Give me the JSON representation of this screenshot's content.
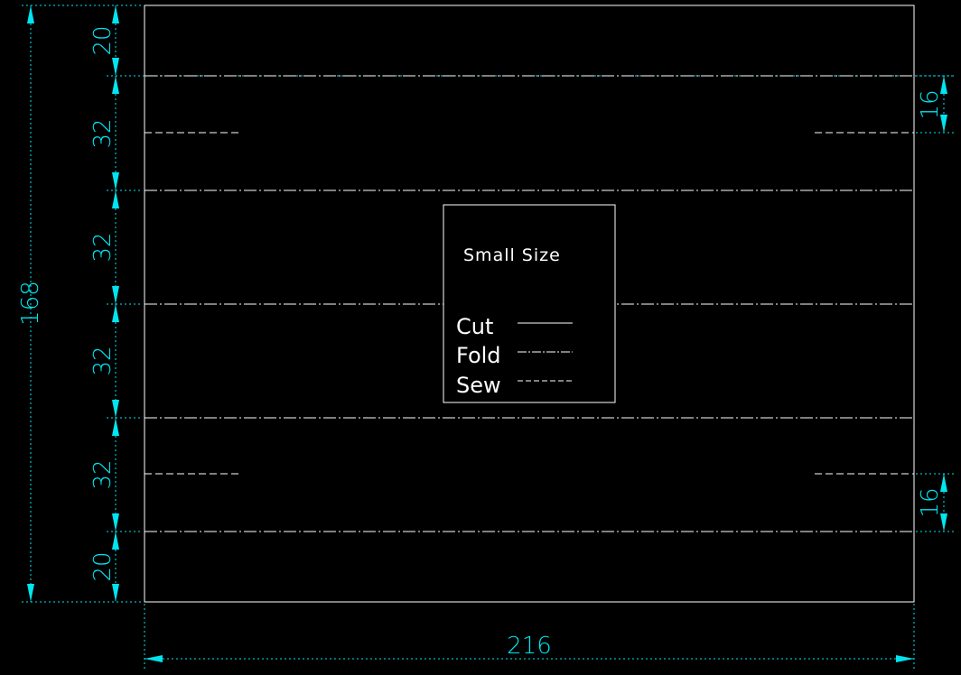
{
  "colors": {
    "background": "#000000",
    "lines": "#ffffff",
    "dimension": "#00e5f0"
  },
  "legend": {
    "title": "Small Size",
    "items": [
      {
        "label": "Cut",
        "line": "solid"
      },
      {
        "label": "Fold",
        "line": "dash-dot"
      },
      {
        "label": "Sew",
        "line": "dashed"
      }
    ]
  },
  "dimensions": {
    "total_height": "168",
    "total_width": "216",
    "segments": [
      "20",
      "32",
      "32",
      "32",
      "32",
      "20"
    ],
    "sew_offset_top": "16",
    "sew_offset_bottom": "16"
  }
}
